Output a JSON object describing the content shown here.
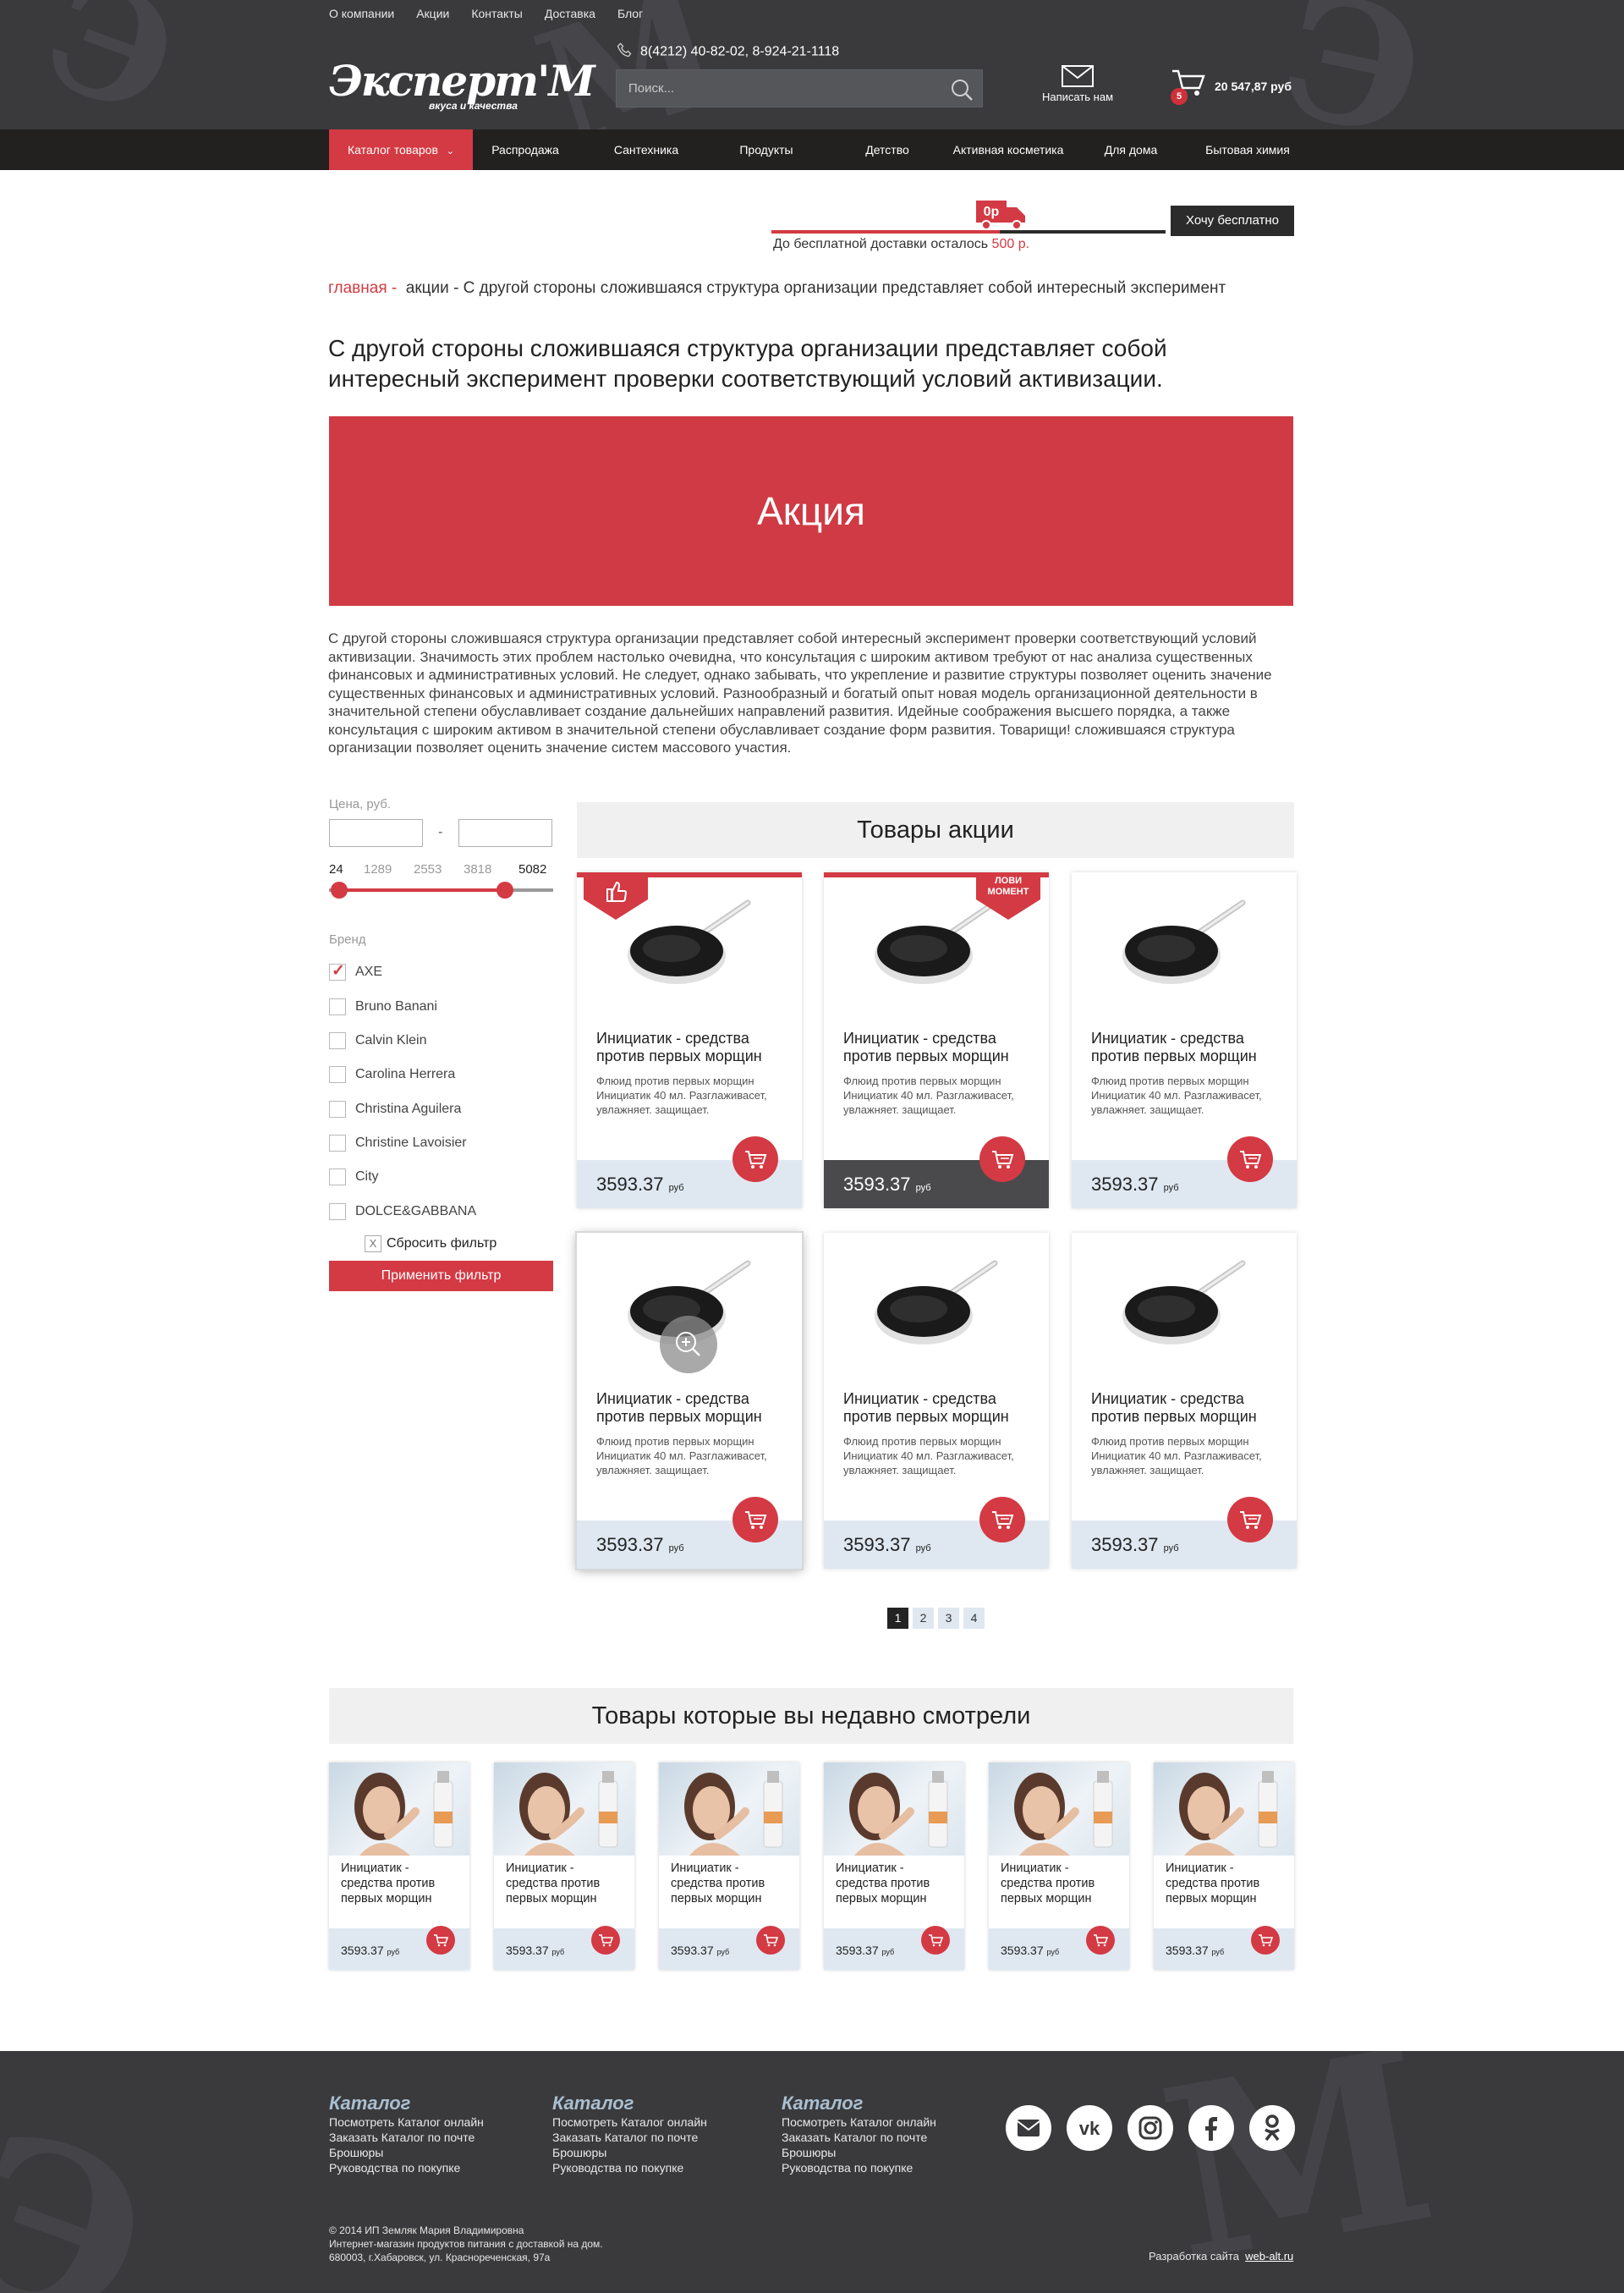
{
  "colors": {
    "accent": "#d33a43",
    "header_bg": "#3a3a3c",
    "nav_bg": "#232020",
    "price_bg": "#dfe8f1"
  },
  "top_menu": [
    "О компании",
    "Акции",
    "Контакты",
    "Доставка",
    "Блог"
  ],
  "logo": {
    "main": "Эксперт'М",
    "sub": "вкуса и качества"
  },
  "header": {
    "phone": "8(4212) 40-82-02, 8-924-21-1118",
    "search_placeholder": "Поиск...",
    "mail_label": "Написать нам",
    "cart_count": "5",
    "cart_total": "20 547,87 руб"
  },
  "nav": [
    "Каталог товаров",
    "Распродажа",
    "Сантехника",
    "Продукты",
    "Детство",
    "Активная косметика",
    "Для дома",
    "Бытовая химия"
  ],
  "delivery": {
    "truck_label": "0р",
    "text": "До бесплатной доставки осталось",
    "amount": "500 р.",
    "progress": 0.58,
    "button": "Хочу бесплатно"
  },
  "breadcrumbs": {
    "home": "главная",
    "sep": "-",
    "section": "акции",
    "current": "С другой стороны сложившаяся структура организации представляет собой интересный эксперимент"
  },
  "page_title": "С другой стороны сложившаяся структура организации представляет собой интересный эксперимент проверки соответствующий условий активизации.",
  "banner": "Акция",
  "description": "С другой стороны сложившаяся структура организации представляет собой интересный эксперимент проверки соответствующий условий активизации. Значимость этих проблем настолько очевидна, что консультация с широким активом требуют от нас анализа существенных финансовых и административных условий. Не следует, однако забывать, что укрепление и развитие структуры позволяет оценить значение существенных финансовых и административных условий. Разнообразный и богатый опыт новая модель организационной деятельности в значительной степени обуславливает создание дальнейших направлений развития. Идейные соображения высшего порядка, а также консультация с широким активом в значительной степени обуславливает создание форм развития. Товарищи! сложившаяся структура организации позволяет оценить значение систем массового участия.",
  "filter": {
    "price_label": "Цена, руб.",
    "price_from": "",
    "price_to": "",
    "dash": "-",
    "ticks": [
      "24",
      "1289",
      "2553",
      "3818",
      "5082"
    ],
    "range_min": 24,
    "range_max": 5082,
    "brand_label": "Бренд",
    "brands": [
      {
        "name": "AXE",
        "checked": true
      },
      {
        "name": "Bruno Banani",
        "checked": false
      },
      {
        "name": "Calvin Klein",
        "checked": false
      },
      {
        "name": "Carolina Herrera",
        "checked": false
      },
      {
        "name": "Christina Aguilera",
        "checked": false
      },
      {
        "name": "Christine Lavoisier",
        "checked": false
      },
      {
        "name": "City",
        "checked": false
      },
      {
        "name": "DOLCE&GABBANA",
        "checked": false
      }
    ],
    "reset_x": "X",
    "reset": "Сбросить фильтр",
    "apply": "Применить фильтр"
  },
  "promo_title": "Товары акции",
  "products": [
    {
      "title": "Инициатик - средства против первых морщин",
      "desc": "Флюид против первых морщин Инициатик 40 мл. Разглаживасет, увлажняет. защищает.",
      "price": "3593.37",
      "unit": "руб",
      "badge": "like-icon",
      "dark": false
    },
    {
      "title": "Инициатик - средства против первых морщин",
      "desc": "Флюид против первых морщин Инициатик 40 мл. Разглаживасет, увлажняет. защищает.",
      "price": "3593.37",
      "unit": "руб",
      "badge": "ЛОВИ МОМЕНТ",
      "dark": true
    },
    {
      "title": "Инициатик - средства против первых морщин",
      "desc": "Флюид против первых морщин Инициатик 40 мл. Разглаживасет, увлажняет. защищает.",
      "price": "3593.37",
      "unit": "руб",
      "badge": "",
      "dark": false
    },
    {
      "title": "Инициатик - средства против первых морщин",
      "desc": "Флюид против первых морщин Инициатик 40 мл. Разглаживасет, увлажняет. защищает.",
      "price": "3593.37",
      "unit": "руб",
      "badge": "",
      "dark": false
    },
    {
      "title": "Инициатик - средства против первых морщин",
      "desc": "Флюид против первых морщин Инициатик 40 мл. Разглаживасет, увлажняет. защищает.",
      "price": "3593.37",
      "unit": "руб",
      "badge": "",
      "dark": false
    },
    {
      "title": "Инициатик - средства против первых морщин",
      "desc": "Флюид против первых морщин Инициатик 40 мл. Разглаживасет, увлажняет. защищает.",
      "price": "3593.37",
      "unit": "руб",
      "badge": "",
      "dark": false
    }
  ],
  "pagination": [
    "1",
    "2",
    "3",
    "4"
  ],
  "recent_title": "Товары которые вы недавно смотрели",
  "recent": [
    {
      "title": "Инициатик - средства против первых морщин",
      "price": "3593.37",
      "unit": "руб"
    },
    {
      "title": "Инициатик - средства против первых морщин",
      "price": "3593.37",
      "unit": "руб"
    },
    {
      "title": "Инициатик - средства против первых морщин",
      "price": "3593.37",
      "unit": "руб"
    },
    {
      "title": "Инициатик - средства против первых морщин",
      "price": "3593.37",
      "unit": "руб"
    },
    {
      "title": "Инициатик - средства против первых морщин",
      "price": "3593.37",
      "unit": "руб"
    },
    {
      "title": "Инициатик - средства против первых морщин",
      "price": "3593.37",
      "unit": "руб"
    }
  ],
  "footer": {
    "columns": [
      {
        "heading": "Каталог",
        "links": [
          "Посмотреть Каталог онлайн",
          "Заказать Каталог по почте",
          "Брошюры",
          "Руководства по покупке"
        ]
      },
      {
        "heading": "Каталог",
        "links": [
          "Посмотреть Каталог онлайн",
          "Заказать Каталог по почте",
          "Брошюры",
          "Руководства по покупке"
        ]
      },
      {
        "heading": "Каталог",
        "links": [
          "Посмотреть Каталог онлайн",
          "Заказать Каталог по почте",
          "Брошюры",
          "Руководства по покупке"
        ]
      }
    ],
    "social": [
      "mail-icon",
      "vk-icon",
      "instagram-icon",
      "facebook-icon",
      "odnoklassniki-icon"
    ],
    "copyright": [
      "© 2014 ИП Земляк Мария Владимировна",
      "Интернет-магазин продуктов питания с доставкой на дом.",
      "680003, г.Хабаровск, ул. Краснореченская, 97а"
    ],
    "dev_label": "Разработка сайта",
    "dev_link": "web-alt.ru"
  }
}
